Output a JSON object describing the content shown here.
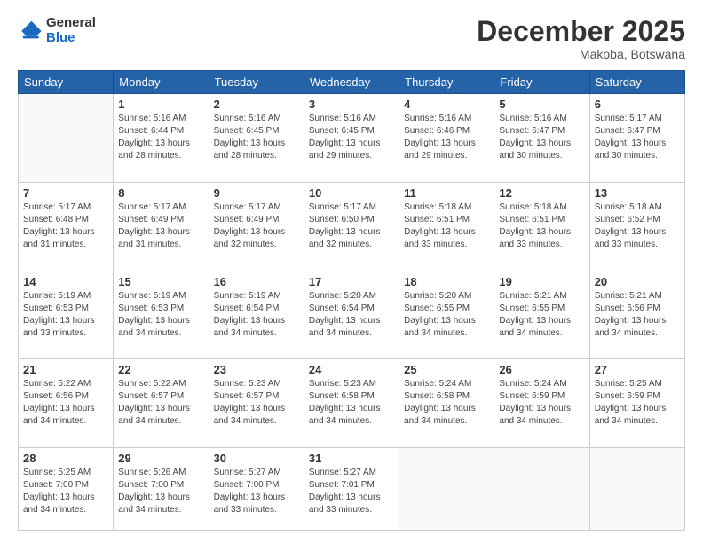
{
  "header": {
    "logo_general": "General",
    "logo_blue": "Blue",
    "month_title": "December 2025",
    "location": "Makoba, Botswana"
  },
  "days_of_week": [
    "Sunday",
    "Monday",
    "Tuesday",
    "Wednesday",
    "Thursday",
    "Friday",
    "Saturday"
  ],
  "weeks": [
    [
      {
        "day": "",
        "info": ""
      },
      {
        "day": "1",
        "info": "Sunrise: 5:16 AM\nSunset: 6:44 PM\nDaylight: 13 hours\nand 28 minutes."
      },
      {
        "day": "2",
        "info": "Sunrise: 5:16 AM\nSunset: 6:45 PM\nDaylight: 13 hours\nand 28 minutes."
      },
      {
        "day": "3",
        "info": "Sunrise: 5:16 AM\nSunset: 6:45 PM\nDaylight: 13 hours\nand 29 minutes."
      },
      {
        "day": "4",
        "info": "Sunrise: 5:16 AM\nSunset: 6:46 PM\nDaylight: 13 hours\nand 29 minutes."
      },
      {
        "day": "5",
        "info": "Sunrise: 5:16 AM\nSunset: 6:47 PM\nDaylight: 13 hours\nand 30 minutes."
      },
      {
        "day": "6",
        "info": "Sunrise: 5:17 AM\nSunset: 6:47 PM\nDaylight: 13 hours\nand 30 minutes."
      }
    ],
    [
      {
        "day": "7",
        "info": "Sunrise: 5:17 AM\nSunset: 6:48 PM\nDaylight: 13 hours\nand 31 minutes."
      },
      {
        "day": "8",
        "info": "Sunrise: 5:17 AM\nSunset: 6:49 PM\nDaylight: 13 hours\nand 31 minutes."
      },
      {
        "day": "9",
        "info": "Sunrise: 5:17 AM\nSunset: 6:49 PM\nDaylight: 13 hours\nand 32 minutes."
      },
      {
        "day": "10",
        "info": "Sunrise: 5:17 AM\nSunset: 6:50 PM\nDaylight: 13 hours\nand 32 minutes."
      },
      {
        "day": "11",
        "info": "Sunrise: 5:18 AM\nSunset: 6:51 PM\nDaylight: 13 hours\nand 33 minutes."
      },
      {
        "day": "12",
        "info": "Sunrise: 5:18 AM\nSunset: 6:51 PM\nDaylight: 13 hours\nand 33 minutes."
      },
      {
        "day": "13",
        "info": "Sunrise: 5:18 AM\nSunset: 6:52 PM\nDaylight: 13 hours\nand 33 minutes."
      }
    ],
    [
      {
        "day": "14",
        "info": "Sunrise: 5:19 AM\nSunset: 6:53 PM\nDaylight: 13 hours\nand 33 minutes."
      },
      {
        "day": "15",
        "info": "Sunrise: 5:19 AM\nSunset: 6:53 PM\nDaylight: 13 hours\nand 34 minutes."
      },
      {
        "day": "16",
        "info": "Sunrise: 5:19 AM\nSunset: 6:54 PM\nDaylight: 13 hours\nand 34 minutes."
      },
      {
        "day": "17",
        "info": "Sunrise: 5:20 AM\nSunset: 6:54 PM\nDaylight: 13 hours\nand 34 minutes."
      },
      {
        "day": "18",
        "info": "Sunrise: 5:20 AM\nSunset: 6:55 PM\nDaylight: 13 hours\nand 34 minutes."
      },
      {
        "day": "19",
        "info": "Sunrise: 5:21 AM\nSunset: 6:55 PM\nDaylight: 13 hours\nand 34 minutes."
      },
      {
        "day": "20",
        "info": "Sunrise: 5:21 AM\nSunset: 6:56 PM\nDaylight: 13 hours\nand 34 minutes."
      }
    ],
    [
      {
        "day": "21",
        "info": "Sunrise: 5:22 AM\nSunset: 6:56 PM\nDaylight: 13 hours\nand 34 minutes."
      },
      {
        "day": "22",
        "info": "Sunrise: 5:22 AM\nSunset: 6:57 PM\nDaylight: 13 hours\nand 34 minutes."
      },
      {
        "day": "23",
        "info": "Sunrise: 5:23 AM\nSunset: 6:57 PM\nDaylight: 13 hours\nand 34 minutes."
      },
      {
        "day": "24",
        "info": "Sunrise: 5:23 AM\nSunset: 6:58 PM\nDaylight: 13 hours\nand 34 minutes."
      },
      {
        "day": "25",
        "info": "Sunrise: 5:24 AM\nSunset: 6:58 PM\nDaylight: 13 hours\nand 34 minutes."
      },
      {
        "day": "26",
        "info": "Sunrise: 5:24 AM\nSunset: 6:59 PM\nDaylight: 13 hours\nand 34 minutes."
      },
      {
        "day": "27",
        "info": "Sunrise: 5:25 AM\nSunset: 6:59 PM\nDaylight: 13 hours\nand 34 minutes."
      }
    ],
    [
      {
        "day": "28",
        "info": "Sunrise: 5:25 AM\nSunset: 7:00 PM\nDaylight: 13 hours\nand 34 minutes."
      },
      {
        "day": "29",
        "info": "Sunrise: 5:26 AM\nSunset: 7:00 PM\nDaylight: 13 hours\nand 34 minutes."
      },
      {
        "day": "30",
        "info": "Sunrise: 5:27 AM\nSunset: 7:00 PM\nDaylight: 13 hours\nand 33 minutes."
      },
      {
        "day": "31",
        "info": "Sunrise: 5:27 AM\nSunset: 7:01 PM\nDaylight: 13 hours\nand 33 minutes."
      },
      {
        "day": "",
        "info": ""
      },
      {
        "day": "",
        "info": ""
      },
      {
        "day": "",
        "info": ""
      }
    ]
  ]
}
